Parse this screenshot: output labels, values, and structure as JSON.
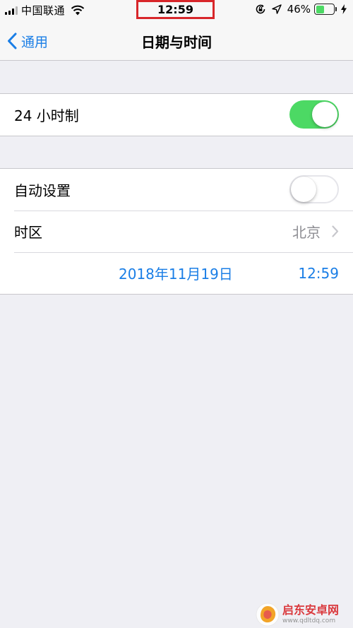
{
  "status_bar": {
    "carrier": "中国联通",
    "time": "12:59",
    "battery_percent": "46%",
    "battery_level": 0.46,
    "icons": [
      "signal-icon",
      "wifi-icon",
      "rotation-lock-icon",
      "location-icon",
      "battery-icon",
      "charging-bolt-icon"
    ]
  },
  "nav": {
    "back_label": "通用",
    "title": "日期与时间"
  },
  "settings": {
    "hour24": {
      "label": "24 小时制",
      "enabled": true
    },
    "auto_set": {
      "label": "自动设置",
      "enabled": false
    },
    "timezone": {
      "label": "时区",
      "value": "北京"
    },
    "datetime": {
      "date": "2018年11月19日",
      "time": "12:59"
    }
  },
  "watermark": {
    "title": "启东安卓网",
    "url": "www.qdltdq.com"
  },
  "colors": {
    "accent": "#1a7ee6",
    "toggle_on": "#4cd964",
    "highlight_box": "#d8262a",
    "background": "#efeff4"
  }
}
